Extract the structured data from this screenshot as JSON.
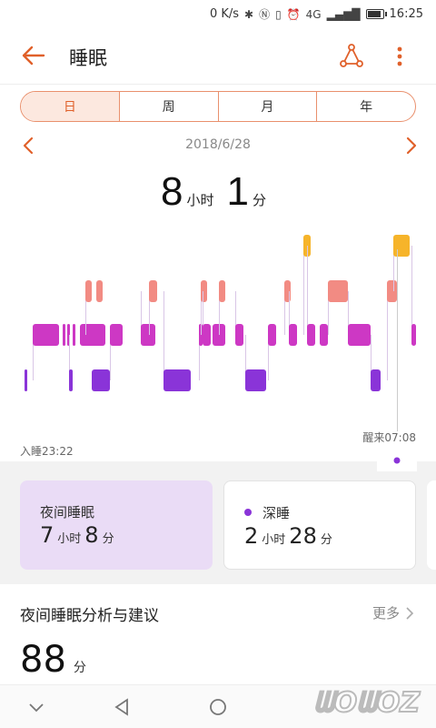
{
  "status": {
    "speed": "0 K/s",
    "signal": "4G",
    "time": "16:25"
  },
  "header": {
    "title": "睡眠"
  },
  "tabs": [
    "日",
    "周",
    "月",
    "年"
  ],
  "active_tab": "日",
  "date": "2018/6/28",
  "total": {
    "hours": "8",
    "hours_unit": "小时",
    "minutes": "1",
    "minutes_unit": "分"
  },
  "chart": {
    "sleep_start_label": "入睡23:22",
    "wake_label": "醒来07:08",
    "levels": [
      "awake",
      "rem",
      "light",
      "deep"
    ],
    "colors": {
      "awake": "#f6b42a",
      "rem": "#f28b83",
      "light": "#cd38c4",
      "deep": "#8a34d8"
    }
  },
  "chart_data": {
    "type": "timeline",
    "x_range": [
      "23:22",
      "07:08"
    ],
    "segments": [
      {
        "stage": "deep",
        "from": 0.12,
        "to": 0.14
      },
      {
        "stage": "light",
        "from": 0.28,
        "to": 0.79
      },
      {
        "stage": "light",
        "from": 0.86,
        "to": 0.89
      },
      {
        "stage": "light",
        "from": 0.96,
        "to": 0.99
      },
      {
        "stage": "light",
        "from": 1.07,
        "to": 1.1
      },
      {
        "stage": "light",
        "from": 1.2,
        "to": 1.7
      },
      {
        "stage": "deep",
        "from": 1.0,
        "to": 1.06
      },
      {
        "stage": "deep",
        "from": 1.44,
        "to": 1.79
      },
      {
        "stage": "light",
        "from": 1.79,
        "to": 2.04
      },
      {
        "stage": "rem",
        "from": 1.32,
        "to": 1.44
      },
      {
        "stage": "rem",
        "from": 1.52,
        "to": 1.64
      },
      {
        "stage": "light",
        "from": 2.4,
        "to": 2.67
      },
      {
        "stage": "rem",
        "from": 2.56,
        "to": 2.72
      },
      {
        "stage": "deep",
        "from": 2.84,
        "to": 3.36
      },
      {
        "stage": "light",
        "from": 3.52,
        "to": 3.6
      },
      {
        "stage": "rem",
        "from": 3.56,
        "to": 3.68
      },
      {
        "stage": "light",
        "from": 3.6,
        "to": 3.76
      },
      {
        "stage": "light",
        "from": 3.8,
        "to": 4.04
      },
      {
        "stage": "rem",
        "from": 3.92,
        "to": 4.04
      },
      {
        "stage": "light",
        "from": 4.24,
        "to": 4.4
      },
      {
        "stage": "deep",
        "from": 4.44,
        "to": 4.84
      },
      {
        "stage": "light",
        "from": 4.88,
        "to": 5.04
      },
      {
        "stage": "rem",
        "from": 5.2,
        "to": 5.32
      },
      {
        "stage": "light",
        "from": 5.28,
        "to": 5.44
      },
      {
        "stage": "awake",
        "from": 5.56,
        "to": 5.7
      },
      {
        "stage": "light",
        "from": 5.64,
        "to": 5.8
      },
      {
        "stage": "light",
        "from": 5.88,
        "to": 6.04
      },
      {
        "stage": "rem",
        "from": 6.04,
        "to": 6.44
      },
      {
        "stage": "light",
        "from": 6.44,
        "to": 6.88
      },
      {
        "stage": "deep",
        "from": 6.88,
        "to": 7.08
      },
      {
        "stage": "rem",
        "from": 7.2,
        "to": 7.4
      },
      {
        "stage": "awake",
        "from": 7.32,
        "to": 7.64
      },
      {
        "stage": "light",
        "from": 7.68,
        "to": 7.76
      }
    ]
  },
  "cards": [
    {
      "title": "夜间睡眠",
      "hours": "7",
      "hours_unit": "小时",
      "minutes": "8",
      "minutes_unit": "分"
    },
    {
      "title": "深睡",
      "hours": "2",
      "hours_unit": "小时",
      "minutes": "28",
      "minutes_unit": "分"
    }
  ],
  "analysis": {
    "title": "夜间睡眠分析与建议",
    "more": "更多",
    "score": "88",
    "score_unit": "分"
  },
  "icons": {
    "back": "arrow-left-icon",
    "share": "share-nodes-icon",
    "more": "more-vertical-icon",
    "prev": "chevron-left-icon",
    "next": "chevron-right-icon"
  }
}
